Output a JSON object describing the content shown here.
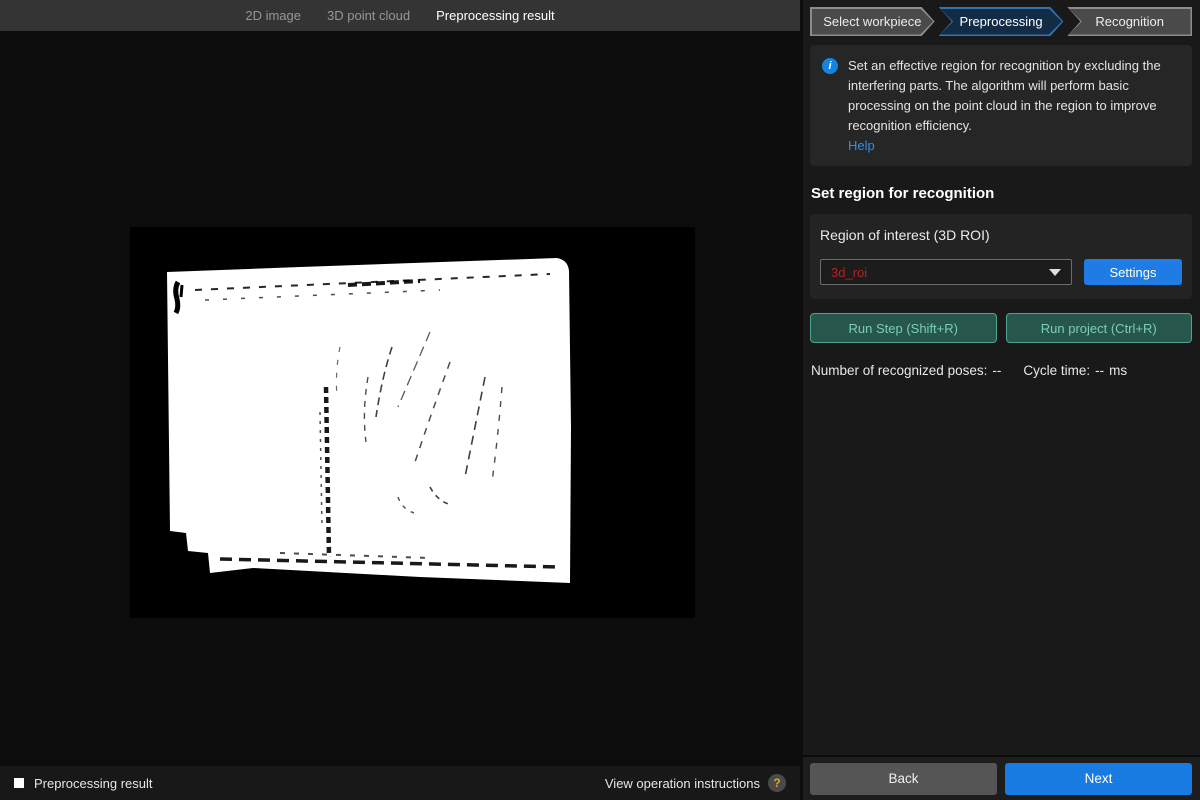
{
  "topbar": {
    "tabs": [
      {
        "label": "2D image",
        "active": false
      },
      {
        "label": "3D point cloud",
        "active": false
      },
      {
        "label": "Preprocessing result",
        "active": true
      }
    ]
  },
  "wizard": {
    "steps": [
      {
        "label": "Select workpiece",
        "active": false
      },
      {
        "label": "Preprocessing",
        "active": true
      },
      {
        "label": "Recognition",
        "active": false
      }
    ]
  },
  "info": {
    "icon": "info-icon",
    "icon_glyph": "i",
    "text": "Set an effective region for recognition by excluding the interfering parts. The algorithm will perform basic processing on the point cloud in the region to improve recognition efficiency.",
    "help_label": "Help"
  },
  "section": {
    "title": "Set region for recognition"
  },
  "roi": {
    "label": "Region of interest (3D ROI)",
    "selected_value": "3d_roi",
    "settings_label": "Settings"
  },
  "run": {
    "step_label": "Run Step (Shift+R)",
    "project_label": "Run project (Ctrl+R)"
  },
  "stats": {
    "poses_label": "Number of recognized poses:",
    "poses_value": "--",
    "cycle_label": "Cycle time:",
    "cycle_value": "--",
    "cycle_unit": "ms"
  },
  "footer": {
    "back_label": "Back",
    "next_label": "Next"
  },
  "statusbar": {
    "left_label": "Preprocessing result",
    "right_label": "View operation instructions",
    "help_glyph": "?"
  },
  "colors": {
    "accent_blue": "#1f7ce4",
    "active_step_border": "#2e75b6",
    "active_step_fill": "#132c45",
    "run_button_border": "#52a492",
    "run_button_text": "#7bcdb9",
    "roi_value_red": "#b92020",
    "help_link_blue": "#2e90ea",
    "help_question_gold": "#d9a62e"
  }
}
